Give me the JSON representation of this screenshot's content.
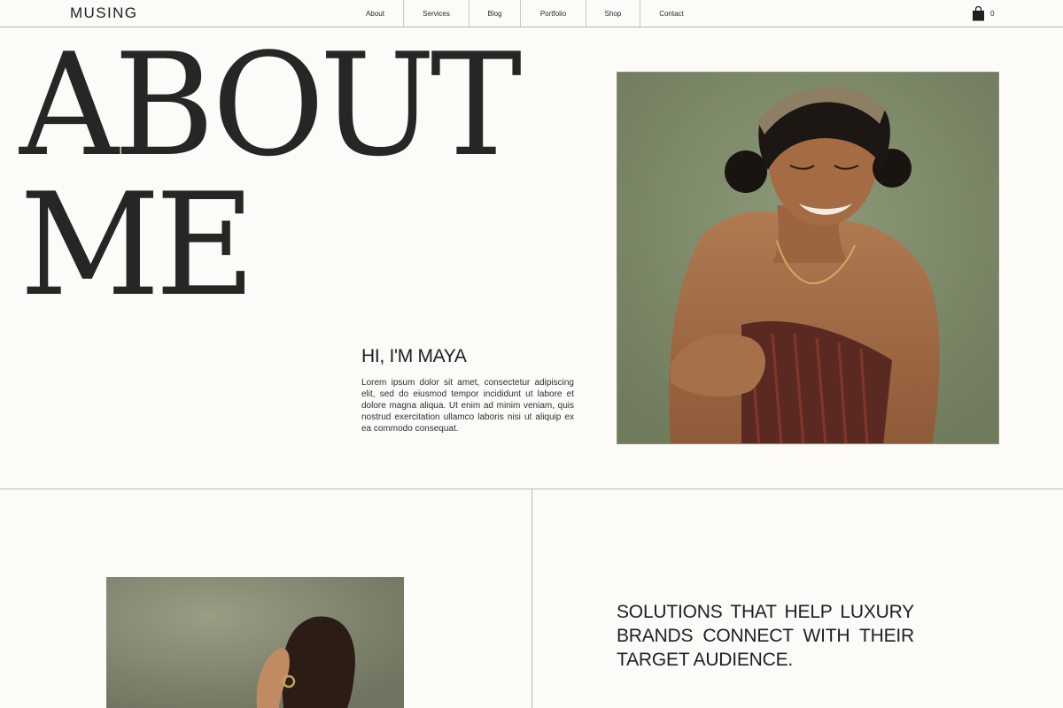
{
  "brand": {
    "logo": "MUSING"
  },
  "nav": {
    "items": [
      {
        "label": "About"
      },
      {
        "label": "Services"
      },
      {
        "label": "Blog"
      },
      {
        "label": "Portfolio"
      },
      {
        "label": "Shop"
      },
      {
        "label": "Contact"
      }
    ]
  },
  "cart": {
    "icon": "shopping-bag-icon",
    "count": "0"
  },
  "hero": {
    "title_line1": "ABOUT",
    "title_line2": "ME"
  },
  "intro": {
    "heading": "HI, I'M MAYA",
    "body": "Lorem ipsum dolor sit amet, consectetur adipiscing elit, sed do eiusmod tempor incididunt ut labore et dolore magna aliqua. Ut enim ad minim veniam, quis nostrud exercitation ullamco laboris nisi ut aliquip ex ea commodo consequat."
  },
  "solutions": {
    "tagline": "SOLUTIONS THAT HELP LUXURY BRANDS CONNECT WITH THEIR TARGET AUDIENCE."
  },
  "colors": {
    "background": "#fcfbf7",
    "text": "#1f1f1f",
    "divider": "#b9b8b4",
    "photo_backdrop": "#7f8d6b"
  }
}
